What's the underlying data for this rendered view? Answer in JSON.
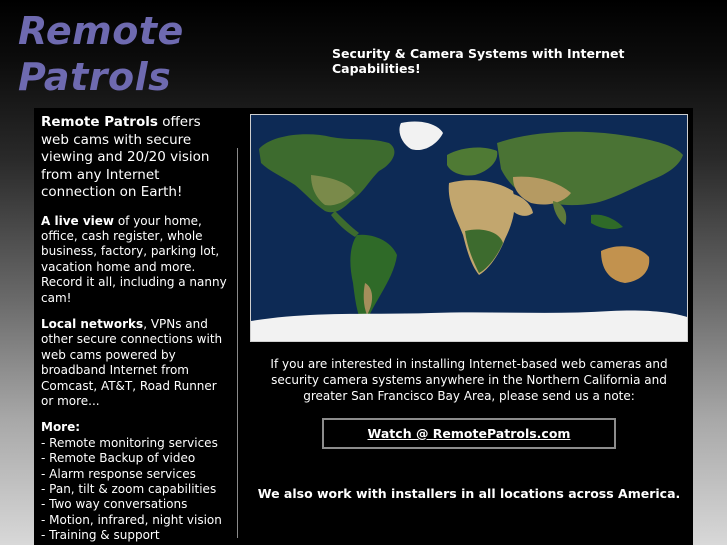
{
  "header": {
    "logo_line1": "Remote",
    "logo_line2": "Patrols",
    "tagline": "Security & Camera Systems with Internet Capabilities!"
  },
  "left": {
    "intro_bold": "Remote Patrols",
    "intro_rest": " offers web cams with secure viewing and 20/20 vision from any Internet connection on Earth!",
    "live_bold": "A live view",
    "live_rest": " of your home, office, cash register, whole business, factory, parking lot, vacation home and more. Record it all, including a nanny cam!",
    "local_bold": "Local networks",
    "local_rest": ", VPNs and other secure connections with web cams powered by broadband Internet from Comcast, AT&T, Road Runner or more...",
    "more_heading": "More:",
    "more_items": [
      "- Remote monitoring services",
      "- Remote Backup of video",
      "- Alarm response services",
      "- Pan, tilt & zoom capabilities",
      "- Two way conversations",
      "- Motion, infrared, night vision",
      "- Training & support"
    ]
  },
  "main": {
    "note": "If you are interested in installing Internet-based web cameras and security camera systems anywhere in the Northern California and greater San Francisco Bay Area, please send us a note:",
    "watch_link": "Watch @ RemotePatrols.com",
    "america": "We also work with installers in all locations across America."
  },
  "colors": {
    "logo": "#6e6ab0",
    "ocean": "#0d2a55",
    "land_green": "#3d6b2e",
    "desert": "#c2a66e",
    "ice": "#f2f2f2"
  }
}
